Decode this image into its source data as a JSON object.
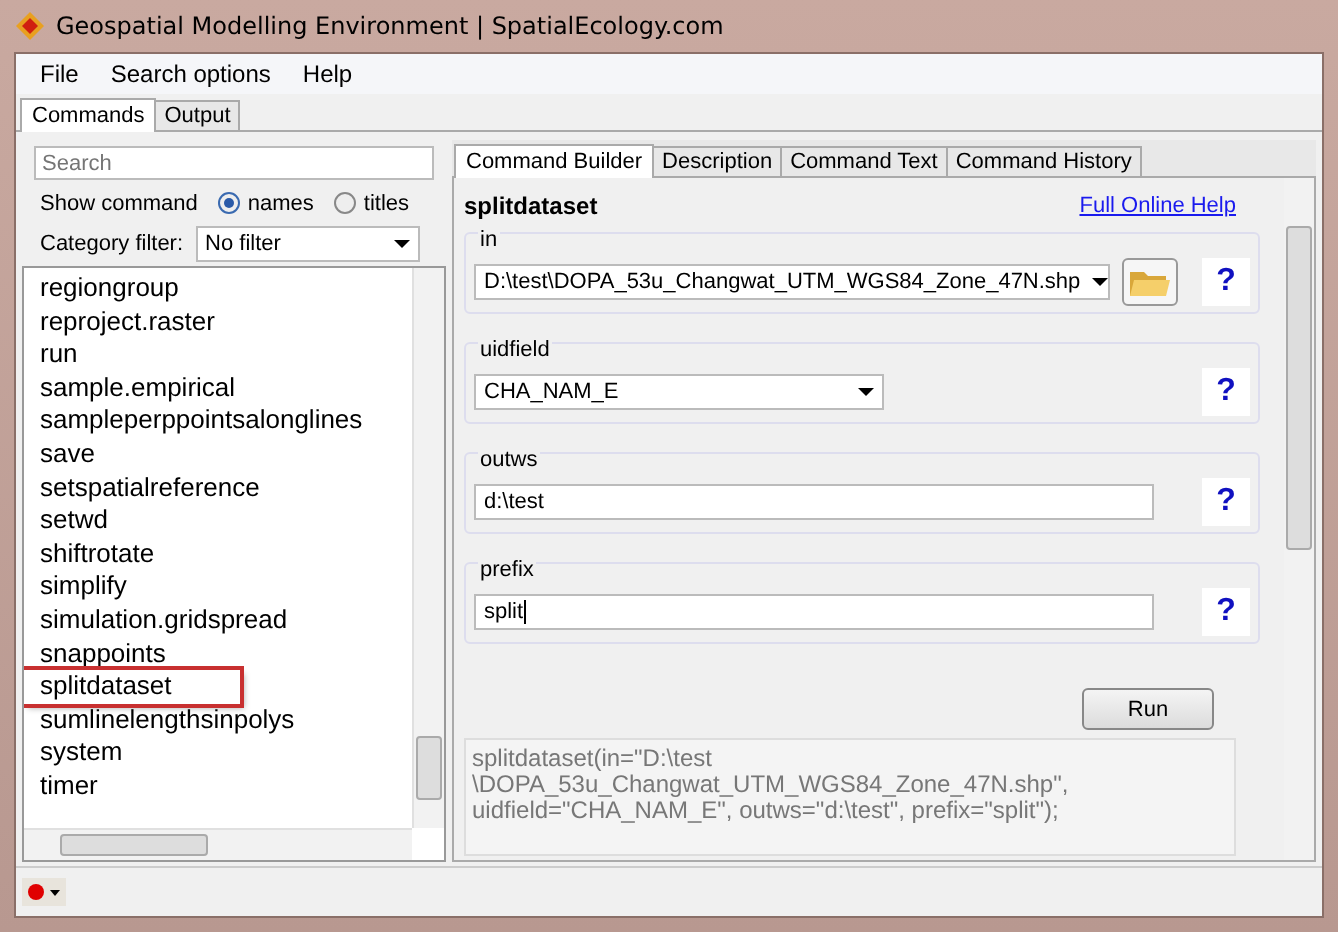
{
  "window": {
    "title": "Geospatial Modelling Environment | SpatialEcology.com"
  },
  "menu": [
    "File",
    "Search options",
    "Help"
  ],
  "tabs": [
    {
      "label": "Commands",
      "selected": true
    },
    {
      "label": "Output",
      "selected": false
    }
  ],
  "sidebar": {
    "search": {
      "placeholder": "Search"
    },
    "show_command": {
      "label": "Show command",
      "options": [
        {
          "label": "names",
          "selected": true
        },
        {
          "label": "titles",
          "selected": false
        }
      ]
    },
    "category_filter": {
      "label": "Category filter:",
      "value": "No filter"
    },
    "commands": [
      {
        "label": "regiongroup",
        "selected": false
      },
      {
        "label": "reproject.raster",
        "selected": false
      },
      {
        "label": "run",
        "selected": false
      },
      {
        "label": "sample.empirical",
        "selected": false
      },
      {
        "label": "sampleperppointsalonglines",
        "selected": false
      },
      {
        "label": "save",
        "selected": false
      },
      {
        "label": "setspatialreference",
        "selected": false
      },
      {
        "label": "setwd",
        "selected": false
      },
      {
        "label": "shiftrotate",
        "selected": false
      },
      {
        "label": "simplify",
        "selected": false
      },
      {
        "label": "simulation.gridspread",
        "selected": false
      },
      {
        "label": "snappoints",
        "selected": false
      },
      {
        "label": "splitdataset",
        "selected": true
      },
      {
        "label": "sumlinelengthsinpolys",
        "selected": false
      },
      {
        "label": "system",
        "selected": false
      },
      {
        "label": "timer",
        "selected": false
      }
    ]
  },
  "builder_tabs": [
    {
      "label": "Command Builder",
      "selected": true
    },
    {
      "label": "Description",
      "selected": false
    },
    {
      "label": "Command Text",
      "selected": false
    },
    {
      "label": "Command History",
      "selected": false
    }
  ],
  "builder": {
    "command": "splitdataset",
    "help_link": "Full Online Help",
    "parameters": [
      {
        "name": "in",
        "kind": "file",
        "value": "D:\\test\\DOPA_53u_Changwat_UTM_WGS84_Zone_47N.shp",
        "help": "?"
      },
      {
        "name": "uidfield",
        "kind": "dropdown",
        "value": "CHA_NAM_E",
        "help": "?"
      },
      {
        "name": "outws",
        "kind": "text",
        "value": "d:\\test",
        "help": "?"
      },
      {
        "name": "prefix",
        "kind": "text",
        "value": "split",
        "help": "?"
      }
    ],
    "run_button": "Run",
    "command_text": [
      "splitdataset(in=\"D:\\test",
      "\\DOPA_53u_Changwat_UTM_WGS84_Zone_47N.shp\",",
      "uidfield=\"CHA_NAM_E\", outws=\"d:\\test\", prefix=\"split\");"
    ]
  }
}
